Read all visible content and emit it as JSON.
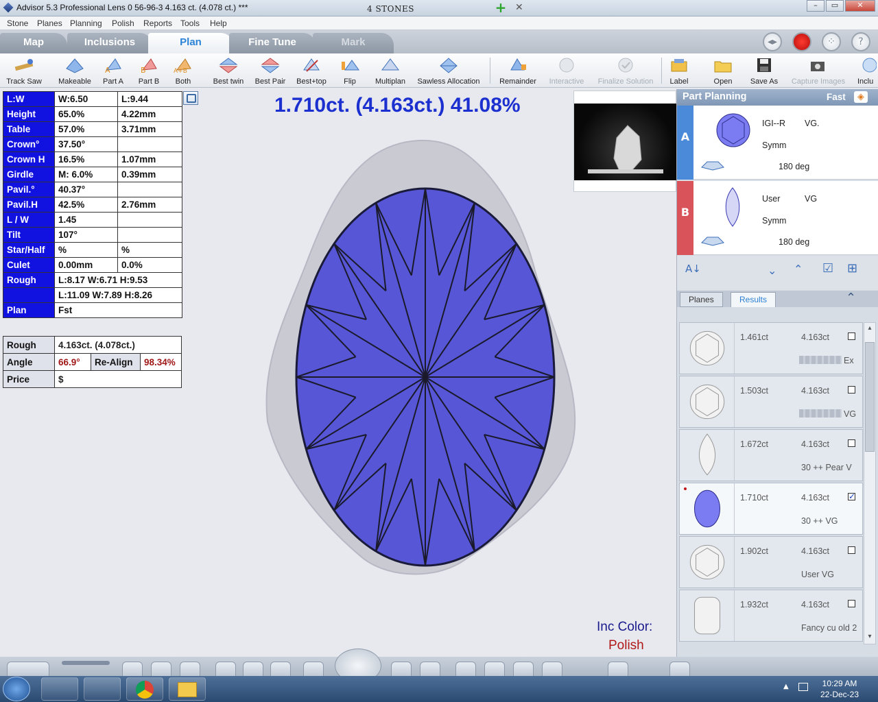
{
  "titlebar": {
    "app_title": "Advisor 5.3 Professional     Lens 0     56-96-3    4.163 ct. (4.078 ct.) ***",
    "stones": "4 STONES",
    "minimize": "–",
    "restore": "▭",
    "close": "✕"
  },
  "menu": [
    "Stone",
    "Planes",
    "Planning",
    "Polish",
    "Reports",
    "Tools",
    "Help"
  ],
  "tabs": [
    {
      "label": "Map"
    },
    {
      "label": "Inclusions"
    },
    {
      "label": "Plan",
      "active": true
    },
    {
      "label": "Fine Tune"
    },
    {
      "label": "Mark",
      "disabled": true
    }
  ],
  "toolbar": [
    {
      "label": "Track Saw",
      "icon": "track-saw-icon"
    },
    {
      "label": "Makeable",
      "icon": "makeable-icon"
    },
    {
      "label": "Part A",
      "icon": "part-a-icon"
    },
    {
      "label": "Part B",
      "icon": "part-b-icon"
    },
    {
      "label": "Both",
      "icon": "both-icon"
    },
    {
      "label": "Best twin",
      "icon": "best-twin-icon"
    },
    {
      "label": "Best Pair",
      "icon": "best-pair-icon"
    },
    {
      "label": "Best+top",
      "icon": "best-top-icon"
    },
    {
      "label": "Flip",
      "icon": "flip-icon"
    },
    {
      "label": "Multiplan",
      "icon": "multiplan-icon"
    },
    {
      "label": "Sawless Allocation",
      "icon": "sawless-allocation-icon"
    },
    {
      "label": "Remainder",
      "icon": "remainder-icon"
    },
    {
      "label": "Interactive",
      "icon": "interactive-icon",
      "disabled": true
    },
    {
      "label": "Finalize Solution",
      "icon": "finalize-icon",
      "disabled": true
    },
    {
      "label": "Label",
      "icon": "label-icon"
    },
    {
      "label": "Open",
      "icon": "folder-icon"
    },
    {
      "label": "Save As",
      "icon": "save-icon"
    },
    {
      "label": "Capture Images",
      "icon": "camera-icon",
      "disabled": true
    },
    {
      "label": "Inclu",
      "icon": "inclusion-icon"
    }
  ],
  "params": [
    {
      "label": "L:W",
      "v1": "W:6.50",
      "v2": "L:9.44"
    },
    {
      "label": "Height",
      "v1": "65.0%",
      "v2": "4.22mm"
    },
    {
      "label": "Table",
      "v1": "57.0%",
      "v2": "3.71mm"
    },
    {
      "label": "Crown°",
      "v1": "37.50°",
      "v2": ""
    },
    {
      "label": "Crown H",
      "v1": "16.5%",
      "v2": "1.07mm"
    },
    {
      "label": "Girdle",
      "v1": "M: 6.0%",
      "v2": "0.39mm"
    },
    {
      "label": "Pavil.°",
      "v1": "40.37°",
      "v2": ""
    },
    {
      "label": "Pavil.H",
      "v1": "42.5%",
      "v2": "2.76mm"
    },
    {
      "label": "L / W",
      "v1": "1.45",
      "v2": ""
    },
    {
      "label": "Tilt",
      "v1": "107°",
      "v2": ""
    },
    {
      "label": "Star/Half",
      "v1": "%",
      "v2": "%"
    },
    {
      "label": "Culet",
      "v1": "0.00mm",
      "v2": "0.0%"
    }
  ],
  "rough_dims": {
    "label": "Rough",
    "line1": "L:8.17 W:6.71 H:9.53",
    "line2": "L:11.09 W:7.89 H:8.26"
  },
  "plan": {
    "label": "Plan",
    "value": "Fst"
  },
  "summary": {
    "rough_label": "Rough",
    "rough_value": "4.163ct. (4.078ct.)",
    "angle_label": "Angle",
    "angle_value": "66.9°",
    "realign_label": "Re-Align",
    "realign_value": "98.34%",
    "price_label": "Price",
    "price_value": "$"
  },
  "main": {
    "header": "1.710ct. (4.163ct.) 41.08%",
    "inc_color_label": "Inc Color:",
    "inc_color_value": "Polish"
  },
  "part_planning": {
    "title": "Part Planning",
    "mode": "Fast",
    "parts": [
      {
        "tag": "A",
        "color": "#4a8ad8",
        "grade": "IGI--R",
        "grade2": "VG.",
        "symm": "Symm",
        "rotation": "180 deg"
      },
      {
        "tag": "B",
        "color": "#d9535a",
        "grade": "User",
        "grade2": "VG",
        "symm": "Symm",
        "rotation": "180 deg"
      }
    ],
    "tabs": [
      {
        "label": "Planes"
      },
      {
        "label": "Results",
        "active": true
      }
    ],
    "results": [
      {
        "weight": "1.461ct",
        "rough": "4.163ct",
        "desc": "Ex",
        "checked": false,
        "shape": "round"
      },
      {
        "weight": "1.503ct",
        "rough": "4.163ct",
        "desc": "VG",
        "checked": false,
        "shape": "round"
      },
      {
        "weight": "1.672ct",
        "rough": "4.163ct",
        "desc": "30 ++  Pear V",
        "checked": false,
        "shape": "pear"
      },
      {
        "weight": "1.710ct",
        "rough": "4.163ct",
        "desc": "30 ++  VG",
        "checked": true,
        "shape": "oval",
        "selected": true
      },
      {
        "weight": "1.902ct",
        "rough": "4.163ct",
        "desc": "User VG",
        "checked": false,
        "shape": "round"
      },
      {
        "weight": "1.932ct",
        "rough": "4.163ct",
        "desc": "Fancy  cu old 2",
        "checked": false,
        "shape": "cushion"
      }
    ]
  },
  "clock": {
    "time": "10:29 AM",
    "date": "22-Dec-23"
  },
  "colors": {
    "param_label_bg": "#1111e0",
    "stone_fill": "#5555d4",
    "accent": "#2a83d6"
  }
}
